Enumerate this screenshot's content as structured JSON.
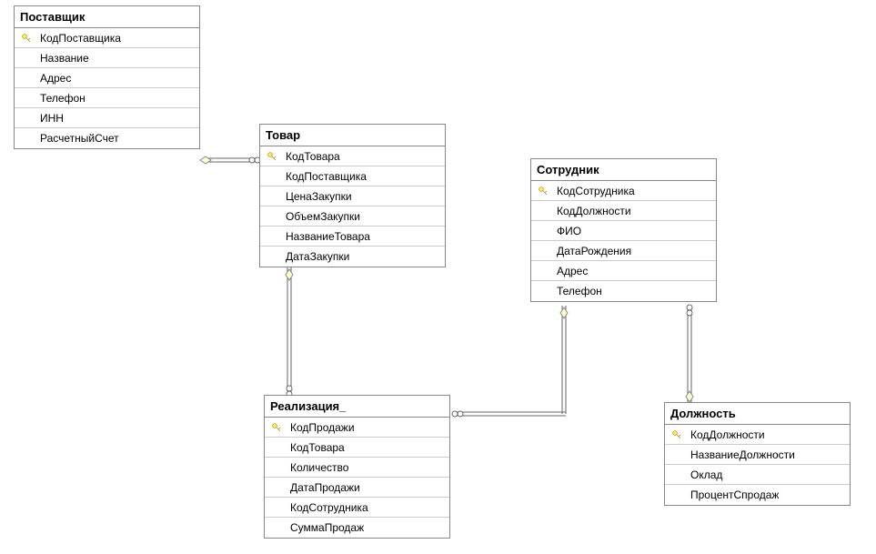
{
  "tables": {
    "supplier": {
      "title": "Поставщик",
      "fields": [
        {
          "name": "КодПоставщика",
          "pk": true
        },
        {
          "name": "Название",
          "pk": false
        },
        {
          "name": "Адрес",
          "pk": false
        },
        {
          "name": "Телефон",
          "pk": false
        },
        {
          "name": "ИНН",
          "pk": false
        },
        {
          "name": "РасчетныйСчет",
          "pk": false
        }
      ]
    },
    "product": {
      "title": "Товар",
      "fields": [
        {
          "name": "КодТовара",
          "pk": true
        },
        {
          "name": "КодПоставщика",
          "pk": false
        },
        {
          "name": "ЦенаЗакупки",
          "pk": false
        },
        {
          "name": "ОбъемЗакупки",
          "pk": false
        },
        {
          "name": "НазваниеТовара",
          "pk": false
        },
        {
          "name": "ДатаЗакупки",
          "pk": false
        }
      ]
    },
    "employee": {
      "title": "Сотрудник",
      "fields": [
        {
          "name": "КодСотрудника",
          "pk": true
        },
        {
          "name": "КодДолжности",
          "pk": false
        },
        {
          "name": "ФИО",
          "pk": false
        },
        {
          "name": "ДатаРождения",
          "pk": false
        },
        {
          "name": "Адрес",
          "pk": false
        },
        {
          "name": "Телефон",
          "pk": false
        }
      ]
    },
    "sale": {
      "title": "Реализация_",
      "fields": [
        {
          "name": "КодПродажи",
          "pk": true
        },
        {
          "name": "КодТовара",
          "pk": false
        },
        {
          "name": "Количество",
          "pk": false
        },
        {
          "name": "ДатаПродажи",
          "pk": false
        },
        {
          "name": "КодСотрудника",
          "pk": false
        },
        {
          "name": "СуммаПродаж",
          "pk": false
        }
      ]
    },
    "position": {
      "title": "Должность",
      "fields": [
        {
          "name": "КодДолжности",
          "pk": true
        },
        {
          "name": "НазваниеДолжности",
          "pk": false
        },
        {
          "name": "Оклад",
          "pk": false
        },
        {
          "name": "ПроцентСпродаж",
          "pk": false
        }
      ]
    }
  },
  "relations": [
    {
      "from": "supplier.КодПоставщика",
      "to": "product.КодПоставщика",
      "type": "one-to-many"
    },
    {
      "from": "product.КодТовара",
      "to": "sale.КодТовара",
      "type": "one-to-many"
    },
    {
      "from": "employee.КодСотрудника",
      "to": "sale.КодСотрудника",
      "type": "one-to-many"
    },
    {
      "from": "position.КодДолжности",
      "to": "employee.КодДолжности",
      "type": "one-to-many"
    }
  ]
}
